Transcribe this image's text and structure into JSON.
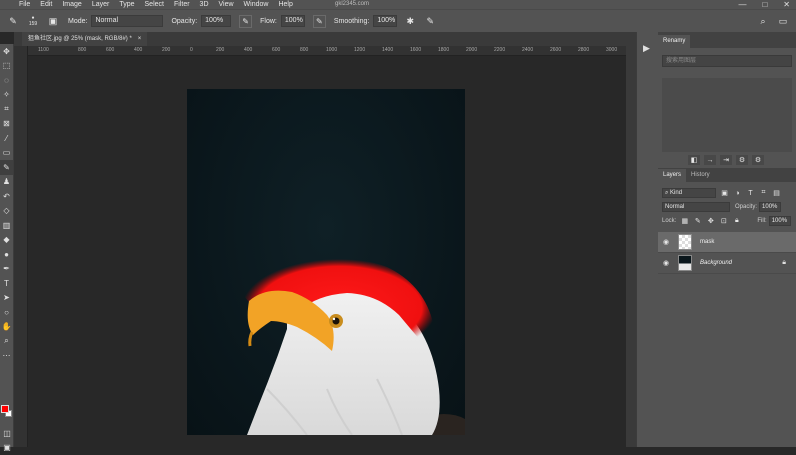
{
  "menubar": {
    "items": [
      "File",
      "Edit",
      "Image",
      "Layer",
      "Type",
      "Select",
      "Filter",
      "3D",
      "View",
      "Window",
      "Help"
    ],
    "site_text": "gkl2345.com",
    "window_controls": [
      "—",
      "□",
      "✕"
    ]
  },
  "options": {
    "brush_size": "159",
    "mode_label": "Mode:",
    "mode_value": "Normal",
    "opacity_label": "Opacity:",
    "opacity_value": "100%",
    "flow_label": "Flow:",
    "flow_value": "100%",
    "smoothing_label": "Smoothing:",
    "smoothing_value": "100%"
  },
  "document": {
    "tab_title": "狙鱼社区.jpg @ 25% (mask, RGB/8#) *",
    "close": "×"
  },
  "ruler": {
    "ticks": [
      "1100",
      "800",
      "600",
      "400",
      "200",
      "0",
      "200",
      "400",
      "600",
      "800",
      "1000",
      "1200",
      "1400",
      "1600",
      "1800",
      "2000",
      "2200",
      "2400",
      "2600",
      "2800",
      "3000"
    ]
  },
  "renamy": {
    "tab": "Renamy",
    "placeholder": "搜索用图层",
    "icons": [
      "◧",
      "→",
      "⇥",
      "⚙",
      "⚙"
    ]
  },
  "layers": {
    "tabs": [
      "Layers",
      "History"
    ],
    "kind_label": "Kind",
    "blend_mode": "Normal",
    "opacity_label": "Opacity:",
    "opacity_value": "100%",
    "lock_label": "Lock:",
    "fill_label": "Fill:",
    "fill_value": "100%",
    "items": [
      {
        "name": "mask",
        "selected": true
      },
      {
        "name": "Background",
        "selected": false,
        "locked": true
      }
    ]
  },
  "colors": {
    "foreground": "#ff0000",
    "background": "#ffffff",
    "paint_overlay": "#ff1a1a"
  }
}
